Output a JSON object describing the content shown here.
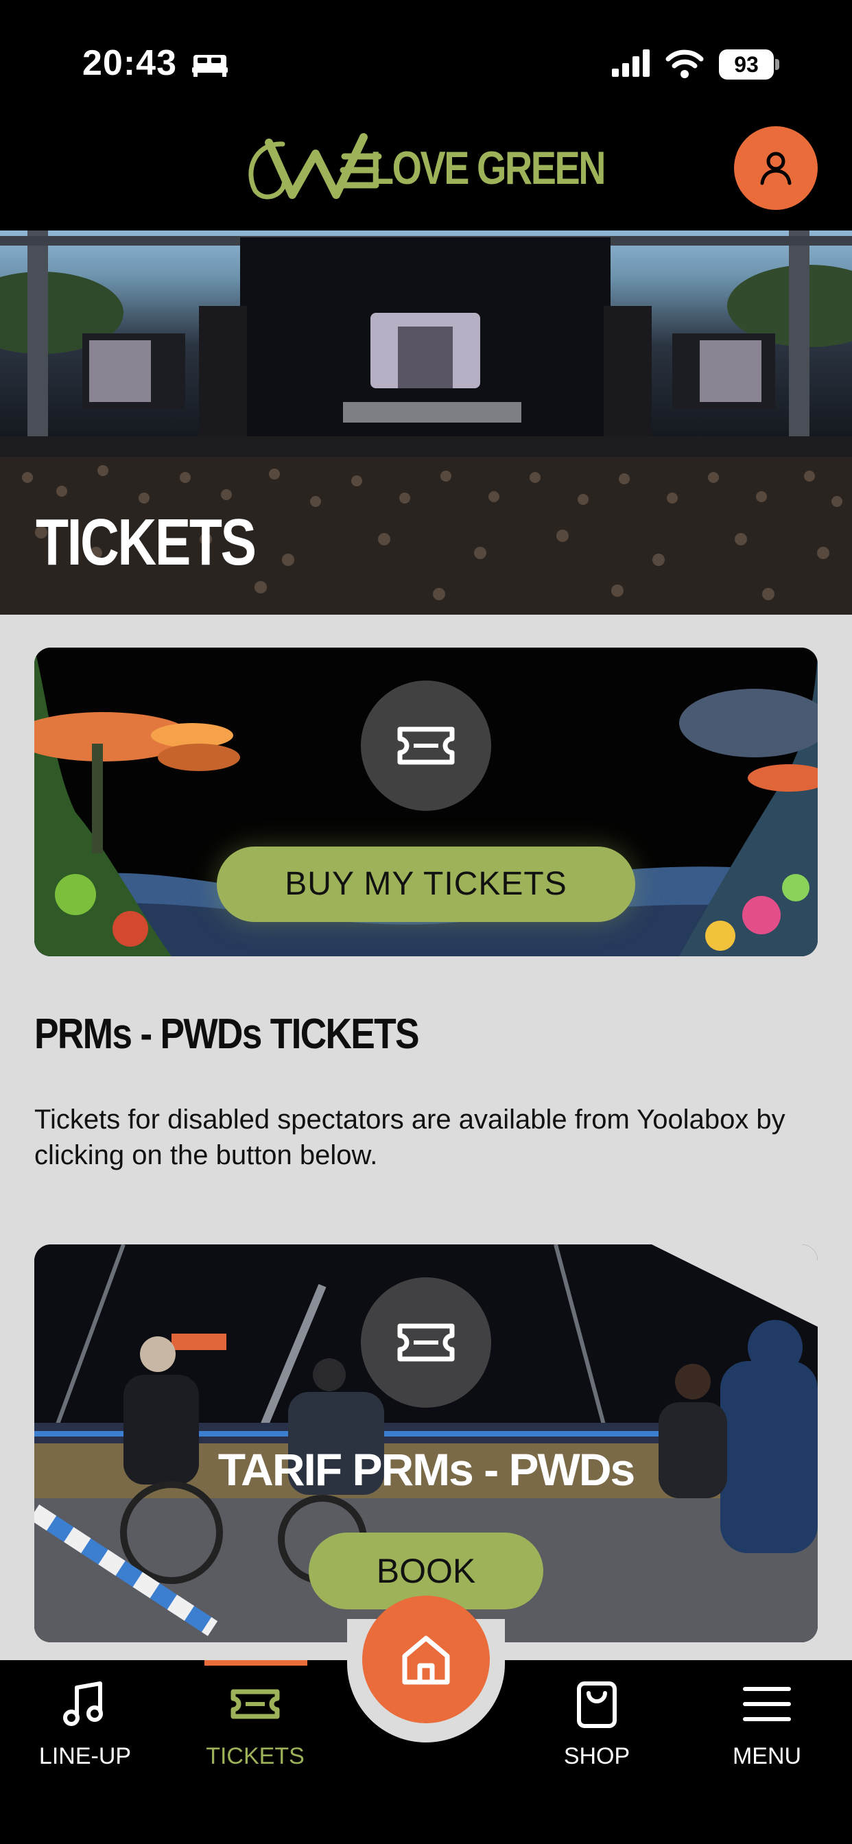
{
  "status_bar": {
    "time": "20:43",
    "battery": "93",
    "icons": [
      "bed-icon",
      "signal-icon",
      "wifi-icon",
      "battery-icon"
    ]
  },
  "header": {
    "logo_script": "We",
    "logo_text": "LOVE GREEN",
    "profile_icon": "user-icon"
  },
  "hero": {
    "title": "TICKETS"
  },
  "cards": {
    "buy": {
      "icon": "ticket-icon",
      "button_label": "BUY MY TICKETS"
    },
    "prm": {
      "icon": "ticket-icon",
      "title": "TARIF PRMs - PWDs",
      "button_label": "BOOK"
    }
  },
  "section": {
    "title": "PRMs - PWDs TICKETS",
    "body": "Tickets for disabled spectators are available from Yoolabox by clicking on the button below."
  },
  "nav": {
    "items": [
      {
        "label": "LINE-UP",
        "icon": "music-note-icon"
      },
      {
        "label": "TICKETS",
        "icon": "ticket-icon",
        "active": true
      },
      {
        "label": "SHOP",
        "icon": "shopping-bag-icon"
      },
      {
        "label": "MENU",
        "icon": "hamburger-menu-icon"
      }
    ],
    "home_icon": "home-icon"
  },
  "colors": {
    "accent_green": "#9db259",
    "accent_orange": "#e96c3a",
    "background": "#dcdcdc",
    "nav_background": "#000000"
  }
}
